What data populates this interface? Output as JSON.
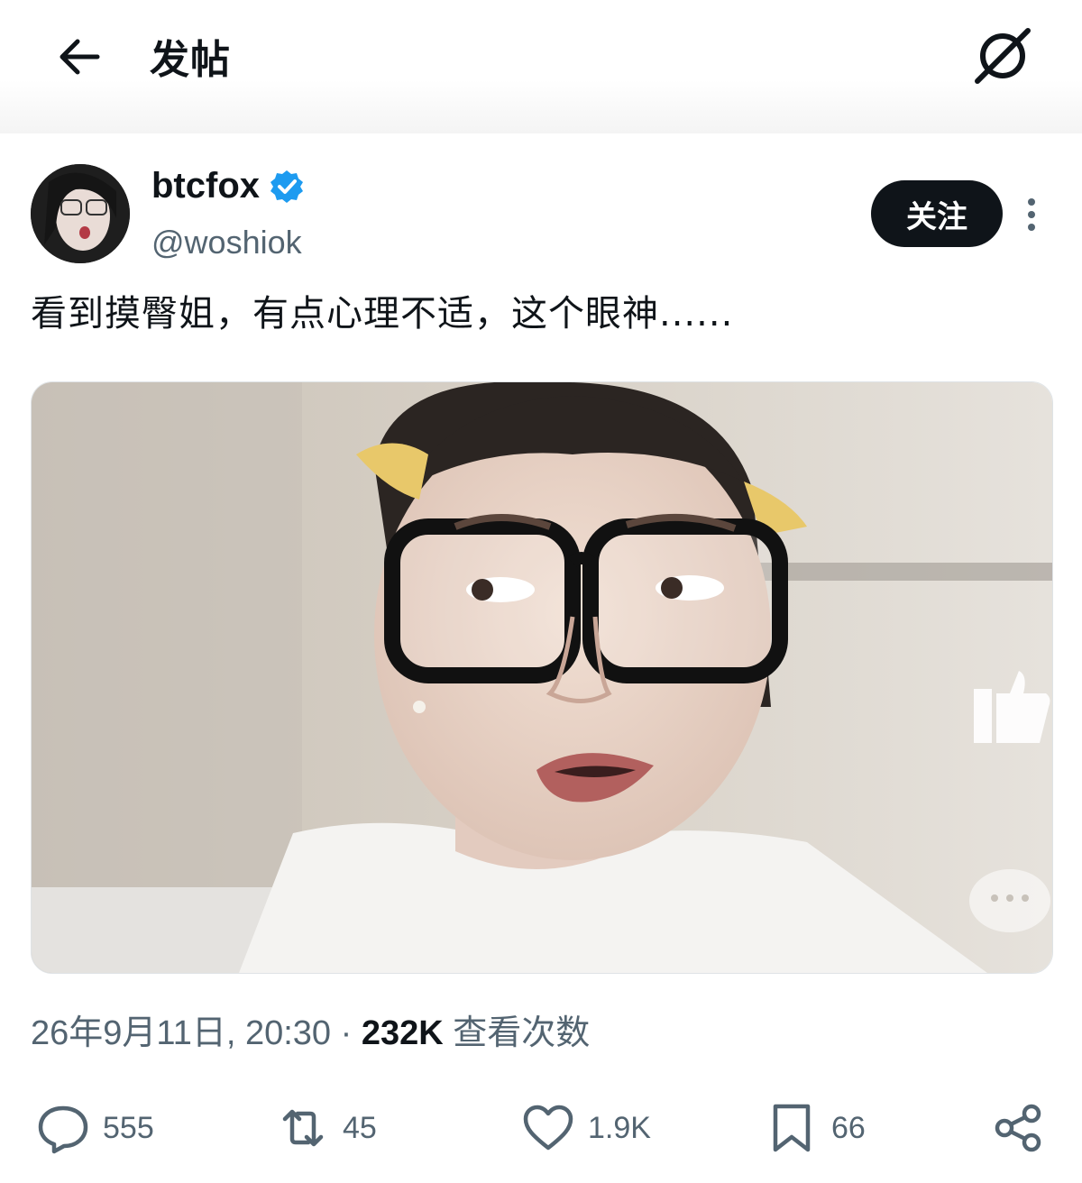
{
  "header": {
    "title": "发帖",
    "back_icon": "arrow-left-icon",
    "grok_icon": "grok-icon"
  },
  "author": {
    "display_name": "btcfox",
    "handle": "@woshiok",
    "verified": true,
    "verified_color": "#1d9bf0",
    "follow_label": "关注"
  },
  "tweet": {
    "text": "看到摸臀姐，有点心理不适，这个眼神......",
    "media_description_icon": "photo-icon"
  },
  "meta": {
    "date": "26年9月11日, 20:30",
    "separator": "·",
    "views": "232K",
    "views_label": "查看次数"
  },
  "actions": {
    "replies": "555",
    "reposts": "45",
    "likes": "1.9K",
    "bookmarks": "66"
  },
  "colors": {
    "text_primary": "#0f1419",
    "text_secondary": "#536471",
    "button_bg": "#0f1419"
  }
}
